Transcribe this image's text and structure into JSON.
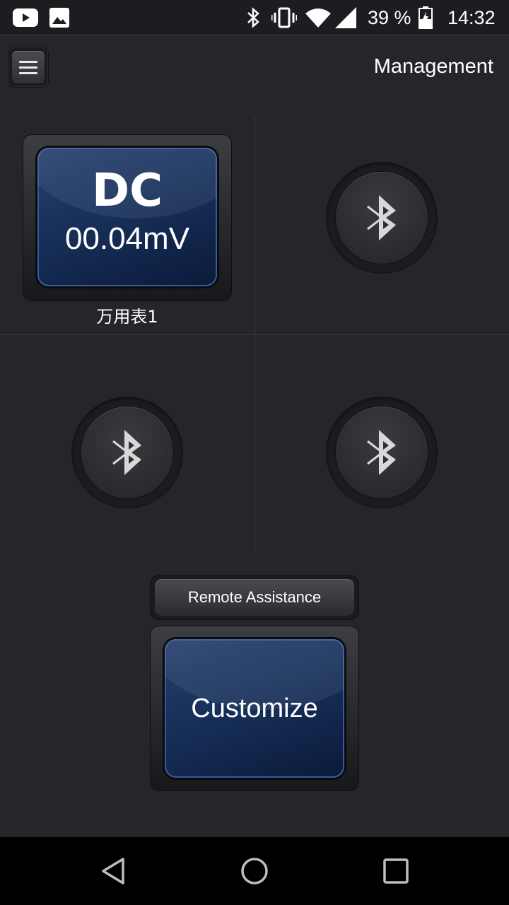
{
  "status_bar": {
    "icons": [
      "youtube-icon",
      "gallery-icon",
      "bluetooth-icon",
      "vibrate-icon",
      "wifi-icon",
      "signal-icon",
      "battery-icon"
    ],
    "battery_percent": "39 %",
    "time": "14:32"
  },
  "app_bar": {
    "menu_icon": "hamburger-menu-icon",
    "title": "Management"
  },
  "devices": [
    {
      "slot": 1,
      "connected": true,
      "mode": "DC",
      "reading": "00.04mV",
      "name": "万用表1"
    },
    {
      "slot": 2,
      "connected": false,
      "icon": "bluetooth-icon"
    },
    {
      "slot": 3,
      "connected": false,
      "icon": "bluetooth-icon"
    },
    {
      "slot": 4,
      "connected": false,
      "icon": "bluetooth-icon"
    }
  ],
  "actions": {
    "remote_assistance_label": "Remote Assistance",
    "customize_label": "Customize"
  },
  "nav_bar": {
    "icons": [
      "back-icon",
      "home-icon",
      "recents-icon"
    ]
  },
  "colors": {
    "background": "#25262a",
    "panel_blue": "#17305a",
    "text": "#ffffff"
  }
}
